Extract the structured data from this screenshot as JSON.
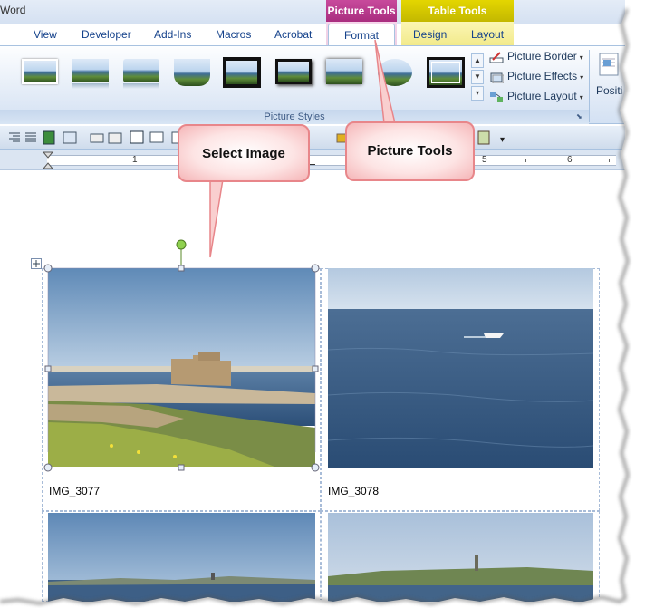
{
  "window": {
    "app_title": "Word"
  },
  "contextual_tabs": {
    "picture_tools": "Picture Tools",
    "table_tools": "Table Tools"
  },
  "tabs": [
    {
      "label": "View"
    },
    {
      "label": "Developer"
    },
    {
      "label": "Add-Ins"
    },
    {
      "label": "Macros"
    },
    {
      "label": "Acrobat"
    },
    {
      "label": "Format",
      "active": true
    },
    {
      "label": "Design"
    },
    {
      "label": "Layout"
    }
  ],
  "ribbon": {
    "group_label": "Picture Styles",
    "side_commands": [
      {
        "label": "Picture Border",
        "icon": "pencil-border-icon"
      },
      {
        "label": "Picture Effects",
        "icon": "picture-effects-icon"
      },
      {
        "label": "Picture Layout",
        "icon": "picture-layout-icon"
      }
    ],
    "position_label": "Positi"
  },
  "ruler": {
    "numbers": [
      "1",
      "5",
      "6"
    ]
  },
  "document": {
    "captions": [
      "IMG_3077",
      "IMG_3078"
    ]
  },
  "callouts": {
    "select_image": "Select Image",
    "picture_tools": "Picture Tools"
  },
  "colors": {
    "picture_tools_accent": "#b8338c",
    "table_tools_accent": "#d4c900",
    "callout_fill": "#fde4e4",
    "callout_border": "#e8868a"
  }
}
